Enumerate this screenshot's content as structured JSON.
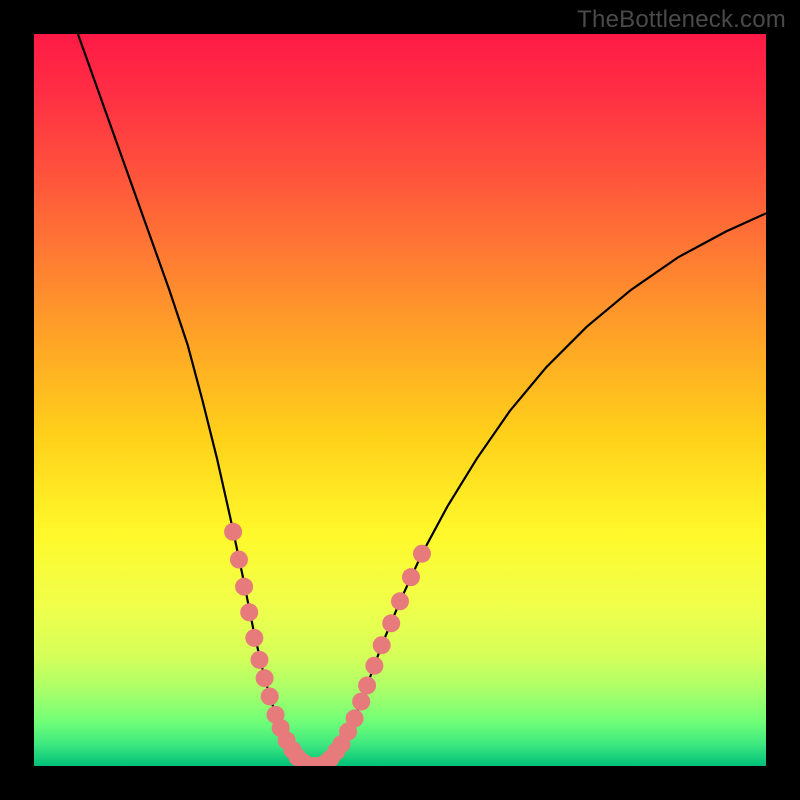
{
  "watermark": "TheBottleneck.com",
  "chart_data": {
    "type": "line",
    "title": "",
    "xlabel": "",
    "ylabel": "",
    "xlim": [
      0,
      1
    ],
    "ylim": [
      0,
      1
    ],
    "grid": false,
    "legend": false,
    "background": {
      "type": "vertical-gradient",
      "stops": [
        {
          "offset": 0.0,
          "color": "#ff1a45"
        },
        {
          "offset": 0.08,
          "color": "#ff2e44"
        },
        {
          "offset": 0.18,
          "color": "#ff4f3d"
        },
        {
          "offset": 0.3,
          "color": "#ff7a33"
        },
        {
          "offset": 0.42,
          "color": "#ffa526"
        },
        {
          "offset": 0.55,
          "color": "#ffd11a"
        },
        {
          "offset": 0.68,
          "color": "#fff82a"
        },
        {
          "offset": 0.78,
          "color": "#f0ff4a"
        },
        {
          "offset": 0.85,
          "color": "#d6ff5a"
        },
        {
          "offset": 0.9,
          "color": "#a6ff6a"
        },
        {
          "offset": 0.94,
          "color": "#70ff78"
        },
        {
          "offset": 0.97,
          "color": "#3fe87f"
        },
        {
          "offset": 1.0,
          "color": "#00c07a"
        }
      ]
    },
    "series": [
      {
        "name": "curve",
        "comment": "V-shaped bottleneck curve; y=1 is top, y=0 is bottom (optimal).",
        "points": [
          {
            "x": 0.06,
            "y": 1.0
          },
          {
            "x": 0.085,
            "y": 0.93
          },
          {
            "x": 0.11,
            "y": 0.86
          },
          {
            "x": 0.135,
            "y": 0.79
          },
          {
            "x": 0.16,
            "y": 0.72
          },
          {
            "x": 0.185,
            "y": 0.65
          },
          {
            "x": 0.21,
            "y": 0.575
          },
          {
            "x": 0.23,
            "y": 0.5
          },
          {
            "x": 0.25,
            "y": 0.42
          },
          {
            "x": 0.268,
            "y": 0.34
          },
          {
            "x": 0.285,
            "y": 0.26
          },
          {
            "x": 0.3,
            "y": 0.185
          },
          {
            "x": 0.315,
            "y": 0.12
          },
          {
            "x": 0.33,
            "y": 0.07
          },
          {
            "x": 0.345,
            "y": 0.035
          },
          {
            "x": 0.36,
            "y": 0.012
          },
          {
            "x": 0.375,
            "y": 0.0
          },
          {
            "x": 0.39,
            "y": 0.0
          },
          {
            "x": 0.405,
            "y": 0.01
          },
          {
            "x": 0.42,
            "y": 0.03
          },
          {
            "x": 0.438,
            "y": 0.065
          },
          {
            "x": 0.455,
            "y": 0.11
          },
          {
            "x": 0.475,
            "y": 0.165
          },
          {
            "x": 0.5,
            "y": 0.225
          },
          {
            "x": 0.53,
            "y": 0.29
          },
          {
            "x": 0.565,
            "y": 0.355
          },
          {
            "x": 0.605,
            "y": 0.42
          },
          {
            "x": 0.65,
            "y": 0.485
          },
          {
            "x": 0.7,
            "y": 0.545
          },
          {
            "x": 0.755,
            "y": 0.6
          },
          {
            "x": 0.815,
            "y": 0.65
          },
          {
            "x": 0.88,
            "y": 0.695
          },
          {
            "x": 0.945,
            "y": 0.73
          },
          {
            "x": 1.0,
            "y": 0.755
          }
        ]
      },
      {
        "name": "highlight-dots",
        "comment": "Salmon dot clusters near the bottom of the V and partway up both arms.",
        "color": "#e77a7a",
        "radius": 9,
        "points": [
          {
            "x": 0.272,
            "y": 0.32
          },
          {
            "x": 0.28,
            "y": 0.282
          },
          {
            "x": 0.287,
            "y": 0.245
          },
          {
            "x": 0.294,
            "y": 0.21
          },
          {
            "x": 0.301,
            "y": 0.175
          },
          {
            "x": 0.308,
            "y": 0.145
          },
          {
            "x": 0.315,
            "y": 0.12
          },
          {
            "x": 0.322,
            "y": 0.095
          },
          {
            "x": 0.33,
            "y": 0.07
          },
          {
            "x": 0.337,
            "y": 0.052
          },
          {
            "x": 0.345,
            "y": 0.035
          },
          {
            "x": 0.353,
            "y": 0.022
          },
          {
            "x": 0.36,
            "y": 0.012
          },
          {
            "x": 0.368,
            "y": 0.005
          },
          {
            "x": 0.375,
            "y": 0.0
          },
          {
            "x": 0.383,
            "y": 0.0
          },
          {
            "x": 0.39,
            "y": 0.0
          },
          {
            "x": 0.398,
            "y": 0.004
          },
          {
            "x": 0.405,
            "y": 0.01
          },
          {
            "x": 0.413,
            "y": 0.02
          },
          {
            "x": 0.42,
            "y": 0.03
          },
          {
            "x": 0.429,
            "y": 0.047
          },
          {
            "x": 0.438,
            "y": 0.065
          },
          {
            "x": 0.447,
            "y": 0.088
          },
          {
            "x": 0.455,
            "y": 0.11
          },
          {
            "x": 0.465,
            "y": 0.137
          },
          {
            "x": 0.475,
            "y": 0.165
          },
          {
            "x": 0.488,
            "y": 0.195
          },
          {
            "x": 0.5,
            "y": 0.225
          },
          {
            "x": 0.515,
            "y": 0.258
          },
          {
            "x": 0.53,
            "y": 0.29
          }
        ]
      }
    ]
  }
}
